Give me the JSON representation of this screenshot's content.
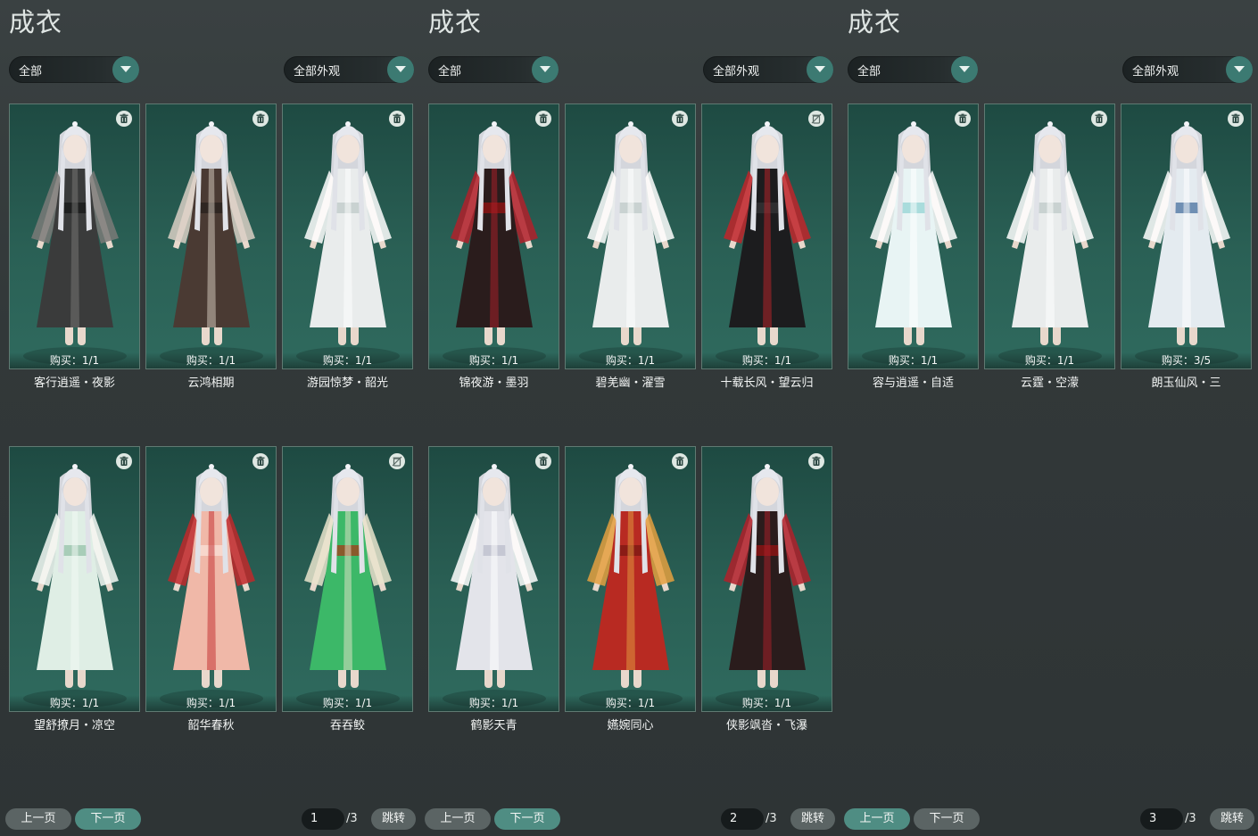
{
  "panels": [
    {
      "title": "成衣",
      "filter_left": "全部",
      "filter_right": "全部外观",
      "items": [
        {
          "buy": "购买：1/1",
          "name": "客行逍遥・夜影",
          "removed": false,
          "palette": "dark"
        },
        {
          "buy": "购买：1/1",
          "name": "云鸿相期",
          "removed": false,
          "palette": "brown"
        },
        {
          "buy": "购买：1/1",
          "name": "游园惊梦・韶光",
          "removed": false,
          "palette": "white"
        },
        {
          "buy": "购买：1/1",
          "name": "望舒撩月・凉空",
          "removed": false,
          "palette": "mint"
        },
        {
          "buy": "购买：1/1",
          "name": "韶华春秋",
          "removed": false,
          "palette": "pink"
        },
        {
          "buy": "购买：1/1",
          "name": "吞吞鲛",
          "removed": true,
          "palette": "green"
        }
      ],
      "prev_label": "上一页",
      "next_label": "下一页",
      "page": "1",
      "total": "/3",
      "jump_label": "跳转"
    },
    {
      "title": "成衣",
      "filter_left": "全部",
      "filter_right": "全部外观",
      "items": [
        {
          "buy": "购买：1/1",
          "name": "锦夜游・墨羽",
          "removed": false,
          "palette": "redblack"
        },
        {
          "buy": "购买：1/1",
          "name": "碧羌幽・濯雪",
          "removed": false,
          "palette": "white"
        },
        {
          "buy": "购买：1/1",
          "name": "十载长风・望云归",
          "removed": true,
          "palette": "black"
        },
        {
          "buy": "购买：1/1",
          "name": "鹤影天青",
          "removed": false,
          "palette": "lilac"
        },
        {
          "buy": "购买：1/1",
          "name": "嬿婉同心",
          "removed": false,
          "palette": "red"
        },
        {
          "buy": "购买：1/1",
          "name": "侠影飒沓・飞瀑",
          "removed": false,
          "palette": "redblack"
        }
      ],
      "prev_label": "上一页",
      "next_label": "下一页",
      "page": "2",
      "total": "/3",
      "jump_label": "跳转"
    },
    {
      "title": "成衣",
      "filter_left": "全部",
      "filter_right": "全部外观",
      "items": [
        {
          "buy": "购买：1/1",
          "name": "容与逍遥・自适",
          "removed": false,
          "palette": "ice"
        },
        {
          "buy": "购买：1/1",
          "name": "云霆・空濛",
          "removed": false,
          "palette": "white"
        },
        {
          "buy": "购买：3/5",
          "name": "朗玉仙风・三",
          "removed": false,
          "palette": "blue"
        }
      ],
      "prev_label": "上一页",
      "next_label": "下一页",
      "page": "3",
      "total": "/3",
      "jump_label": "跳转"
    }
  ],
  "icons": {
    "dropdown": "chevron-down-icon",
    "trash": "trash-icon",
    "removed": "trash-disabled-icon"
  },
  "colors": {
    "accent": "#4f8d83",
    "card_bg": "#2a6055",
    "panel_bg": "#323839"
  }
}
